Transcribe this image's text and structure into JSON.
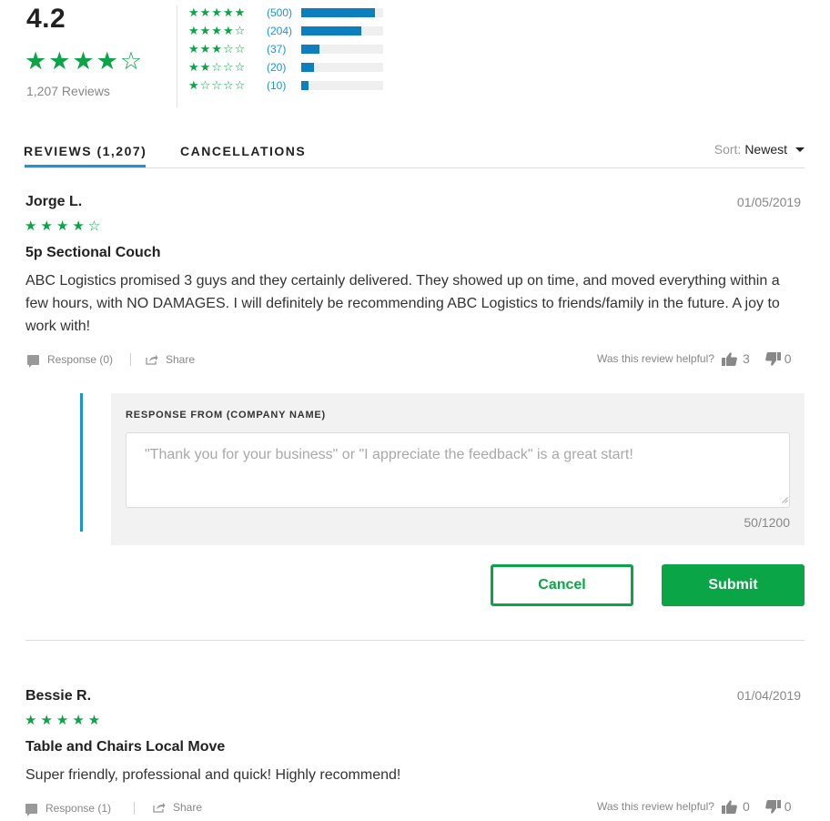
{
  "summary": {
    "average": "4.2",
    "average_stars": "★★★★☆",
    "reviews_count": "1,207 Reviews",
    "histogram": [
      {
        "stars": "★★★★★",
        "count": "(500)",
        "fill": 0.9
      },
      {
        "stars": "★★★★☆",
        "count": "(204)",
        "fill": 0.73
      },
      {
        "stars": "★★★☆☆",
        "count": "(37)",
        "fill": 0.22
      },
      {
        "stars": "★★☆☆☆",
        "count": "(20)",
        "fill": 0.16
      },
      {
        "stars": "★☆☆☆☆",
        "count": "(10)",
        "fill": 0.09
      }
    ]
  },
  "tabs": {
    "reviews": "REVIEWS (1,207)",
    "cancellations": "CANCELLATIONS"
  },
  "sort": {
    "label": "Sort:",
    "value": "Newest"
  },
  "reviews": [
    {
      "name": "Jorge L.",
      "date": "01/05/2019",
      "stars": "★★★★☆",
      "title": "5p Sectional Couch",
      "body": "ABC Logistics promised 3 guys and they certainly delivered. They showed up on time, and moved everything within a few hours, with NO DAMAGES. I will definitely be recommending ABC Logistics to friends/family in the future. A joy to work with!",
      "response_label": "Response (0)",
      "share_label": "Share",
      "helpful_label": "Was this review helpful?",
      "up_votes": "3",
      "down_votes": "0"
    },
    {
      "name": "Bessie R.",
      "date": "01/04/2019",
      "stars": "★★★★★",
      "title": "Table and Chairs Local Move",
      "body": "Super friendly, professional and quick! Highly recommend!",
      "response_label": "Response (1)",
      "share_label": "Share",
      "helpful_label": "Was this review helpful?",
      "up_votes": "0",
      "down_votes": "0"
    }
  ],
  "response_form": {
    "label": "RESPONSE FROM (COMPANY NAME)",
    "placeholder": "\"Thank you for your business\" or \"I appreciate the feedback\" is a great start!",
    "counter": "50/1200",
    "cancel": "Cancel",
    "submit": "Submit"
  },
  "colors": {
    "star_green": "#0aa547",
    "link_blue": "#1b95d4",
    "bar_blue": "#0d7fbf"
  }
}
